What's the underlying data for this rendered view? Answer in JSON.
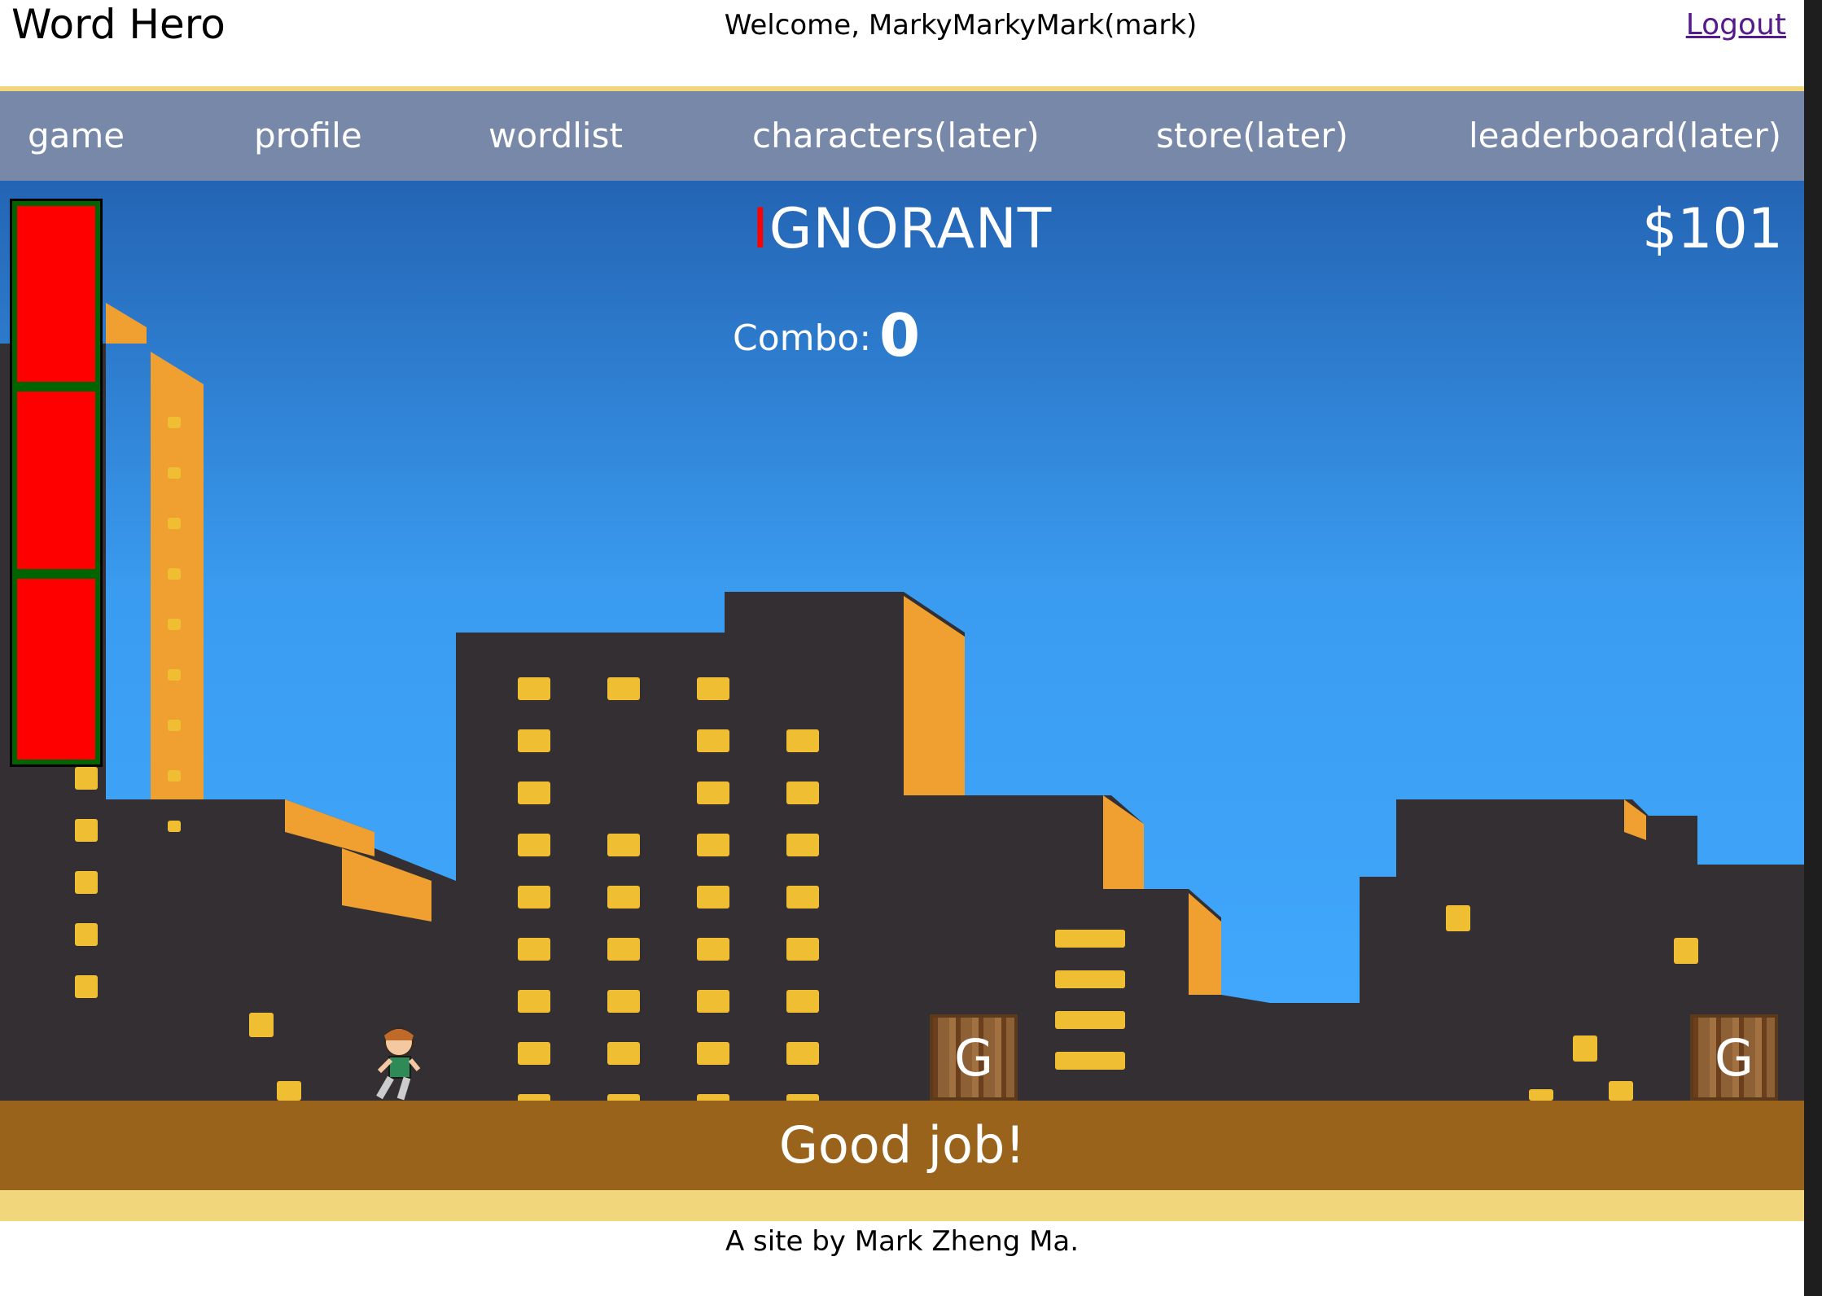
{
  "header": {
    "title": "Word Hero",
    "welcome": "Welcome, MarkyMarkyMark(mark)",
    "logout_label": "Logout"
  },
  "nav": {
    "items": [
      "game",
      "profile",
      "wordlist",
      "characters(later)",
      "store(later)",
      "leaderboard(later)"
    ]
  },
  "game": {
    "word_current_letter": "I",
    "word_rest": "GNORANT",
    "money": "$101",
    "combo_label": "Combo:",
    "combo_value": "0",
    "health_bars_filled": 3,
    "crates": [
      "G",
      "G"
    ],
    "status": "Good job!"
  },
  "footer": {
    "credit": "A site by Mark Zheng Ma."
  },
  "colors": {
    "nav_bg": "#7888a9",
    "accent_gold": "#f1d67b",
    "status_bar": "#99631c",
    "health_fill": "#ff0000",
    "health_border": "#006400",
    "building": "#342f33",
    "window": "#f0be33",
    "building_side": "#f0a030"
  }
}
